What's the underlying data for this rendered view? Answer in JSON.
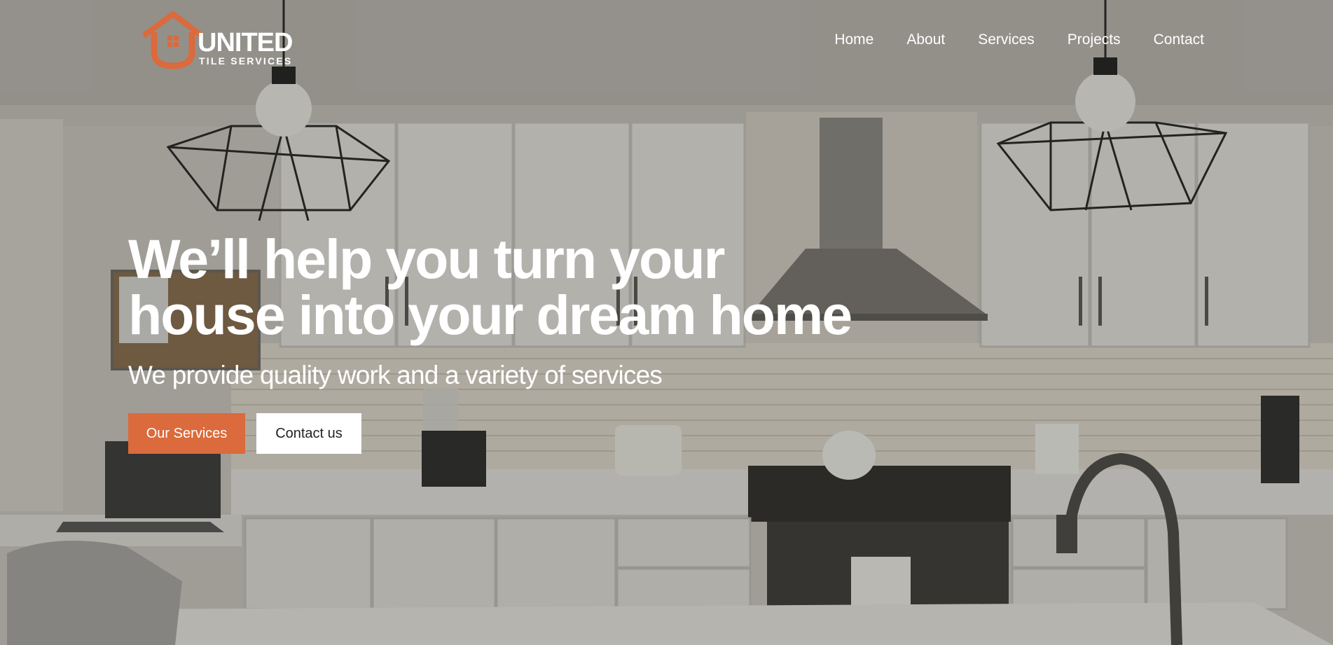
{
  "brand": {
    "name": "UNITED",
    "tagline": "TILE SERVICES",
    "accent_color": "#db6a3c",
    "logo_icon": "house-icon"
  },
  "nav": {
    "items": [
      "Home",
      "About",
      "Services",
      "Projects",
      "Contact"
    ]
  },
  "hero": {
    "headline_line1": "We’ll help you turn your",
    "headline_line2": "house into your dream home",
    "subheadline": "We provide quality work and a variety of services",
    "primary_button": "Our Services",
    "secondary_button": "Contact us",
    "background_image": "kitchen-interior-photo"
  }
}
